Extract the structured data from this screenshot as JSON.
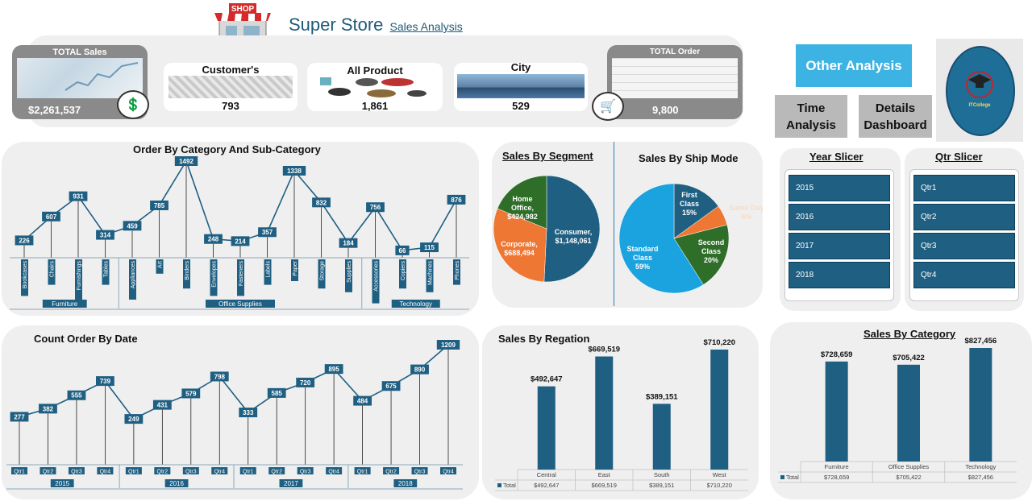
{
  "header": {
    "logo_text": "SHOP",
    "title": "Super Store",
    "subtitle": "Sales Analysis"
  },
  "kpis": {
    "total_sales": {
      "title": "TOTAL Sales",
      "value": "$2,261,537"
    },
    "customers": {
      "title": "Customer's",
      "value": "793"
    },
    "products": {
      "title": "All Product",
      "value": "1,861"
    },
    "city": {
      "title": "City",
      "value": "529"
    },
    "total_order": {
      "title": "TOTAL Order",
      "value": "9,800"
    }
  },
  "nav": {
    "other_analysis": "Other Analysis",
    "time_analysis": "Time Analysis",
    "details_dashboard": "Details Dashboard",
    "college_logo_text": "ITCollege"
  },
  "slicers": {
    "year": {
      "title": "Year Slicer",
      "items": [
        "2015",
        "2016",
        "2017",
        "2018"
      ]
    },
    "qtr": {
      "title": "Qtr Slicer",
      "items": [
        "Qtr1",
        "Qtr2",
        "Qtr3",
        "Qtr4"
      ]
    }
  },
  "colors": {
    "bar": "#1f5f82",
    "accent": "#3db3e3",
    "orange": "#ee7733",
    "green": "#2e6e28",
    "sky": "#1aa3df"
  },
  "chart_data": [
    {
      "id": "order-by-category",
      "type": "line",
      "title": "Order By Category And Sub-Category",
      "groups": [
        {
          "name": "Furniture",
          "categories": [
            "Bookcases",
            "Chairs",
            "Furnishings",
            "Tables"
          ],
          "values": [
            226,
            607,
            931,
            314
          ]
        },
        {
          "name": "Office Supplies",
          "categories": [
            "Appliances",
            "Art",
            "Binders",
            "Envelopes",
            "Fasteners",
            "Labels",
            "Paper",
            "Storage",
            "Supplies"
          ],
          "values": [
            459,
            785,
            1492,
            248,
            214,
            357,
            1338,
            832,
            184
          ]
        },
        {
          "name": "Technology",
          "categories": [
            "Accessories",
            "Copiers",
            "Machines",
            "Phones"
          ],
          "values": [
            756,
            66,
            115,
            876
          ]
        }
      ]
    },
    {
      "id": "sales-by-segment",
      "type": "pie",
      "title": "Sales By Segment",
      "labels": [
        "Consumer",
        "Corporate",
        "Home Office"
      ],
      "values": [
        1148061,
        688494,
        424982
      ],
      "display": [
        "Consumer, $1,148,061",
        "Corporate, $688,494",
        "Home Office, $424,982"
      ]
    },
    {
      "id": "sales-by-ship-mode",
      "type": "pie",
      "title": "Sales By Ship Mode",
      "labels": [
        "First Class",
        "Same Day",
        "Second Class",
        "Standard Class"
      ],
      "values": [
        15,
        6,
        20,
        59
      ],
      "display": [
        "First Class 15%",
        "Same Day 6%",
        "Second Class 20%",
        "Standard Class 59%"
      ]
    },
    {
      "id": "count-order-by-date",
      "type": "line",
      "title": "Count Order By Date",
      "groups": [
        {
          "name": "2015",
          "categories": [
            "Qtr1",
            "Qtr2",
            "Qtr3",
            "Qtr4"
          ],
          "values": [
            277,
            382,
            555,
            739
          ]
        },
        {
          "name": "2016",
          "categories": [
            "Qtr1",
            "Qtr2",
            "Qtr3",
            "Qtr4"
          ],
          "values": [
            249,
            431,
            579,
            798
          ]
        },
        {
          "name": "2017",
          "categories": [
            "Qtr1",
            "Qtr2",
            "Qtr3",
            "Qtr4"
          ],
          "values": [
            333,
            585,
            720,
            895
          ]
        },
        {
          "name": "2018",
          "categories": [
            "Qtr1",
            "Qtr2",
            "Qtr3",
            "Qtr4"
          ],
          "values": [
            484,
            675,
            890,
            1209
          ]
        }
      ]
    },
    {
      "id": "sales-by-region",
      "type": "bar",
      "title": "Sales By Regation",
      "categories": [
        "Central",
        "East",
        "South",
        "West"
      ],
      "values": [
        492647,
        669519,
        389151,
        710220
      ],
      "labels": [
        "$492,647",
        "$669,519",
        "$389,151",
        "$710,220"
      ],
      "table_label": "Total"
    },
    {
      "id": "sales-by-category",
      "type": "bar",
      "title": "Sales By Category",
      "categories": [
        "Furniture",
        "Office Supplies",
        "Technology"
      ],
      "values": [
        728659,
        705422,
        827456
      ],
      "labels": [
        "$728,659",
        "$705,422",
        "$827,456"
      ],
      "table_label": "Total"
    }
  ]
}
